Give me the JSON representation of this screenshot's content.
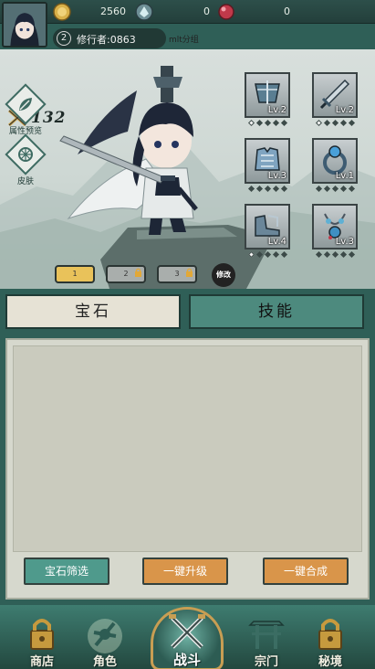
{
  "resources": [
    {
      "icon": "gold-coin-icon",
      "value": "2560"
    },
    {
      "icon": "spirit-stone-icon",
      "value": "0"
    },
    {
      "icon": "red-orb-icon",
      "value": "0"
    }
  ],
  "player": {
    "level": "2",
    "name": "修行者:0863",
    "server": "mlt分组"
  },
  "power": "132",
  "side_buttons": [
    {
      "icon": "leaf-icon",
      "label": "属性预览"
    },
    {
      "icon": "skin-icon",
      "label": "皮肤"
    }
  ],
  "equipment": [
    {
      "icon": "helmet-icon",
      "level": "Lv.2",
      "stars": [
        1,
        0,
        0,
        0,
        0
      ]
    },
    {
      "icon": "sword-icon",
      "level": "Lv.2",
      "stars": [
        1,
        0,
        0,
        0,
        0
      ]
    },
    {
      "icon": "armor-icon",
      "level": "Lv.3",
      "stars": [
        0,
        0,
        0,
        0,
        0
      ]
    },
    {
      "icon": "ring-icon",
      "level": "Lv.1",
      "stars": [
        0,
        0,
        0,
        0,
        0
      ]
    },
    {
      "icon": "boots-icon",
      "level": "Lv.4",
      "stars": [
        1,
        0,
        0,
        0,
        0
      ]
    },
    {
      "icon": "necklace-icon",
      "level": "Lv.3",
      "stars": [
        0,
        0,
        0,
        0,
        0
      ]
    }
  ],
  "loadout_slots": [
    {
      "label": "1",
      "locked": false
    },
    {
      "label": "2",
      "locked": true
    },
    {
      "label": "3",
      "locked": true
    }
  ],
  "edit_label": "修改",
  "tabs": {
    "left": "宝石",
    "right": "技能"
  },
  "actions": {
    "filter": "宝石筛选",
    "upgrade_all": "一键升级",
    "combine_all": "一键合成"
  },
  "nav": {
    "shop": "商店",
    "character": "角色",
    "battle": "战斗",
    "sect": "宗门",
    "secret": "秘境"
  },
  "colors": {
    "frame": "#2f5f57",
    "gold_slot": "#e9c25a",
    "teal_button": "#4f9a8c",
    "orange_button": "#d9954a"
  }
}
